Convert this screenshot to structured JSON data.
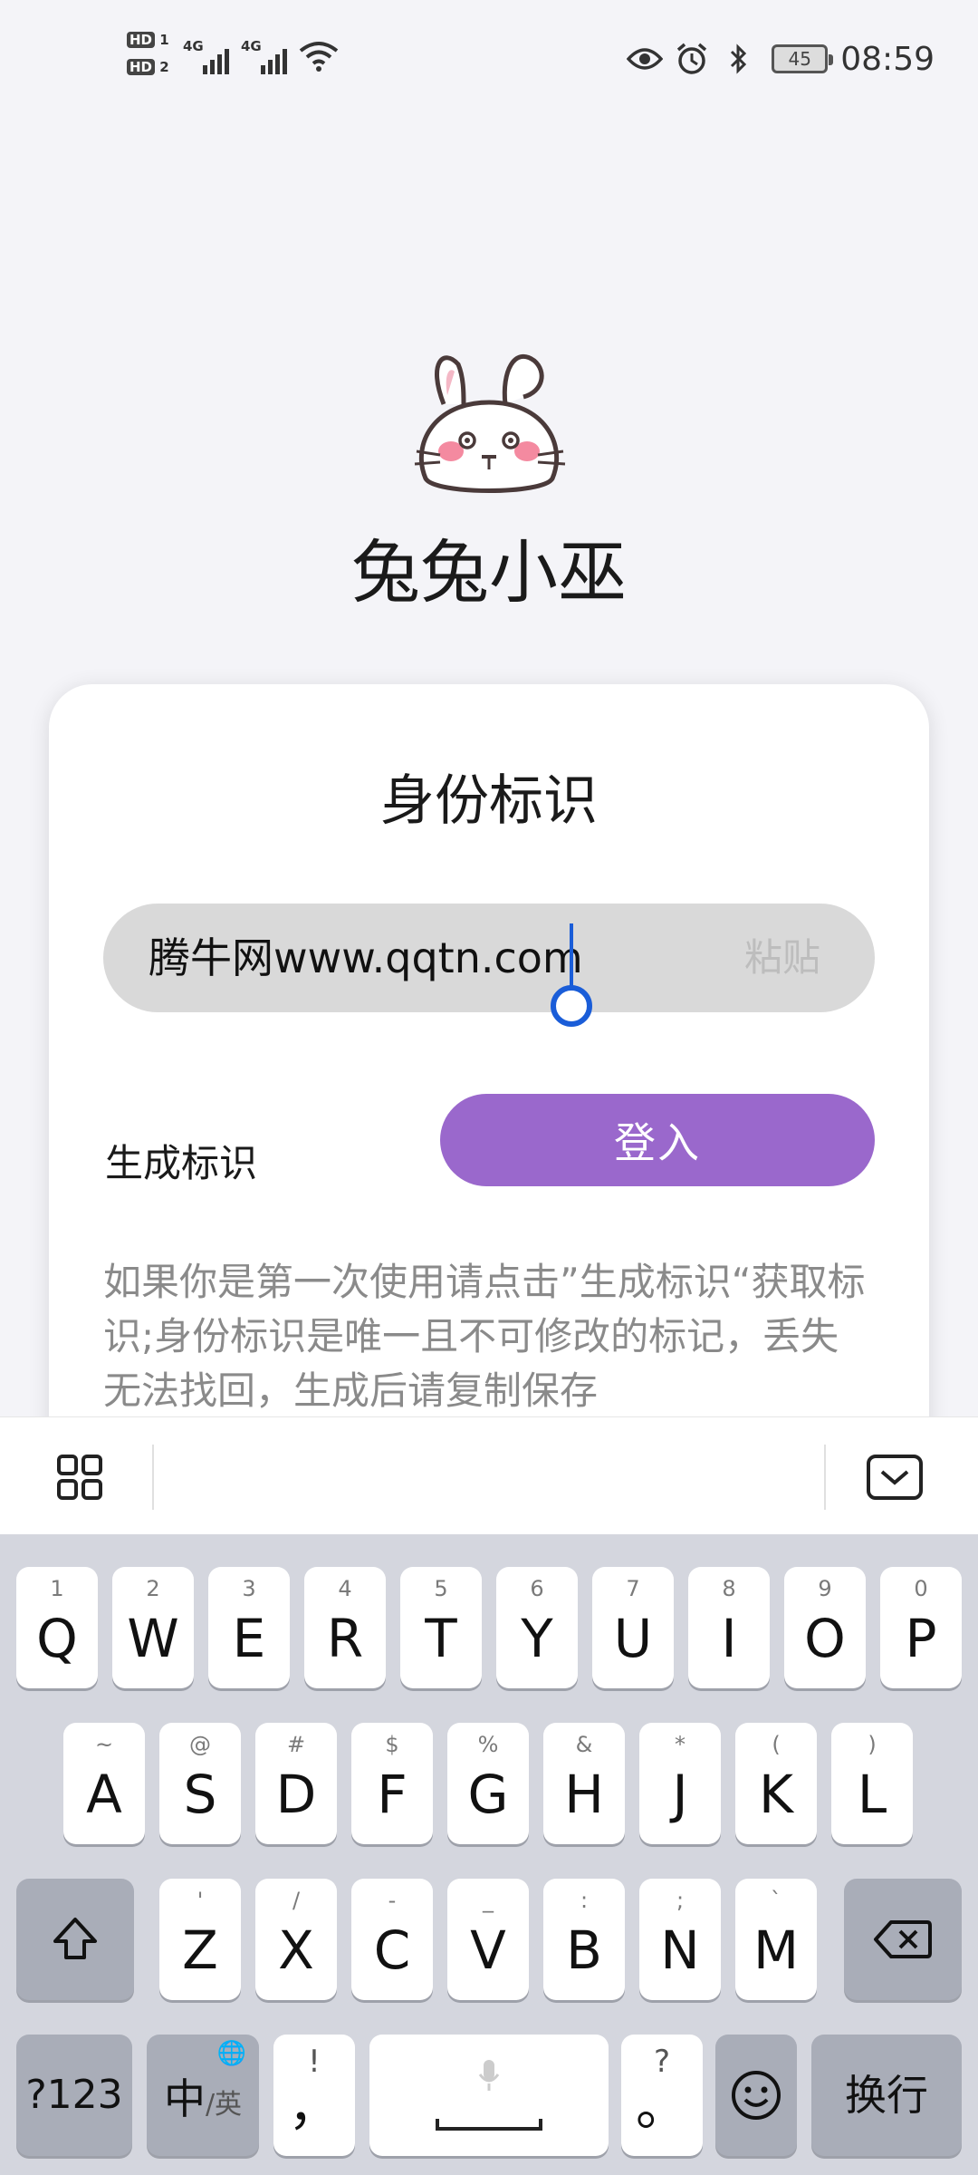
{
  "status_bar": {
    "sim1": "1",
    "sim2": "2",
    "hd_label": "HD",
    "network1": "4G",
    "network2": "4G",
    "battery": "45",
    "time": "08:59"
  },
  "app": {
    "title": "兔兔小巫"
  },
  "card": {
    "title": "身份标识",
    "id_value": "腾牛网www.qqtn.com",
    "paste_label": "粘贴",
    "generate_label": "生成标识",
    "login_label": "登入",
    "hint": "如果你是第一次使用请点击”生成标识“获取标识;身份标识是唯一且不可修改的标记，丢失无法找回，生成后请复制保存"
  },
  "colors": {
    "accent": "#9a68cc",
    "caret": "#1a5dd8",
    "field_bg": "#d9d9d9"
  },
  "keyboard": {
    "row1": [
      {
        "main": "Q",
        "sub": "1"
      },
      {
        "main": "W",
        "sub": "2"
      },
      {
        "main": "E",
        "sub": "3"
      },
      {
        "main": "R",
        "sub": "4"
      },
      {
        "main": "T",
        "sub": "5"
      },
      {
        "main": "Y",
        "sub": "6"
      },
      {
        "main": "U",
        "sub": "7"
      },
      {
        "main": "I",
        "sub": "8"
      },
      {
        "main": "O",
        "sub": "9"
      },
      {
        "main": "P",
        "sub": "0"
      }
    ],
    "row2": [
      {
        "main": "A",
        "sub": "~"
      },
      {
        "main": "S",
        "sub": "@"
      },
      {
        "main": "D",
        "sub": "#"
      },
      {
        "main": "F",
        "sub": "$"
      },
      {
        "main": "G",
        "sub": "%"
      },
      {
        "main": "H",
        "sub": "&"
      },
      {
        "main": "J",
        "sub": "*"
      },
      {
        "main": "K",
        "sub": "("
      },
      {
        "main": "L",
        "sub": ")"
      }
    ],
    "row3": [
      {
        "main": "Z",
        "sub": "'"
      },
      {
        "main": "X",
        "sub": "/"
      },
      {
        "main": "C",
        "sub": "-"
      },
      {
        "main": "V",
        "sub": "_"
      },
      {
        "main": "B",
        "sub": ":"
      },
      {
        "main": "N",
        "sub": ";"
      },
      {
        "main": "M",
        "sub": "`"
      }
    ],
    "symbols_label": "?123",
    "lang_primary": "中",
    "lang_secondary": "/英",
    "comma_main": "，",
    "comma_sub": "!",
    "period_main": "。",
    "period_sub": "?",
    "enter_label": "换行"
  }
}
